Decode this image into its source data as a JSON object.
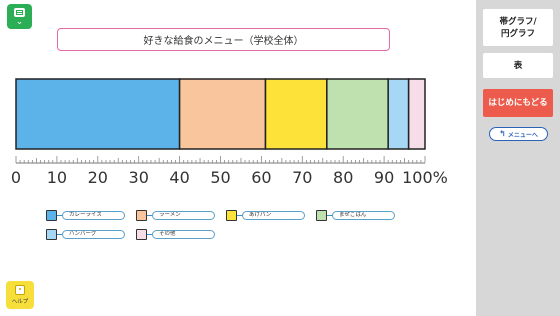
{
  "app": {
    "title": "好きな給食のメニュー（学校全体）",
    "help_label": "ヘルプ"
  },
  "sidebar": {
    "graph_button": "帯グラフ/\n円グラフ",
    "table_button": "表",
    "start_button": "はじめにもどる",
    "menu_button": "メニューへ"
  },
  "colors": {
    "sidebar_bg": "#d7d7d7",
    "menu_green": "#2cae56",
    "start_red": "#ec5b4c",
    "title_border": "#e46aa5",
    "help_yellow": "#f6df3a"
  },
  "chart_data": {
    "type": "stacked-bar",
    "orientation": "horizontal",
    "title": "好きな給食のメニュー（学校全体）",
    "axis_unit": "%",
    "xlim": [
      0,
      100
    ],
    "tick_labels": [
      "0",
      "10",
      "20",
      "30",
      "40",
      "50",
      "60",
      "70",
      "80",
      "90",
      "100%"
    ],
    "series": [
      {
        "name": "カレーライス",
        "value": 40,
        "color": "#5bb3ea"
      },
      {
        "name": "ラーメン",
        "value": 21,
        "color": "#f8c59d"
      },
      {
        "name": "あげパン",
        "value": 15,
        "color": "#fde23a"
      },
      {
        "name": "まぜごはん",
        "value": 15,
        "color": "#bfe0af"
      },
      {
        "name": "ハンバーグ",
        "value": 5,
        "color": "#a6d8f6"
      },
      {
        "name": "その他",
        "value": 4,
        "color": "#f6dde8"
      }
    ]
  }
}
